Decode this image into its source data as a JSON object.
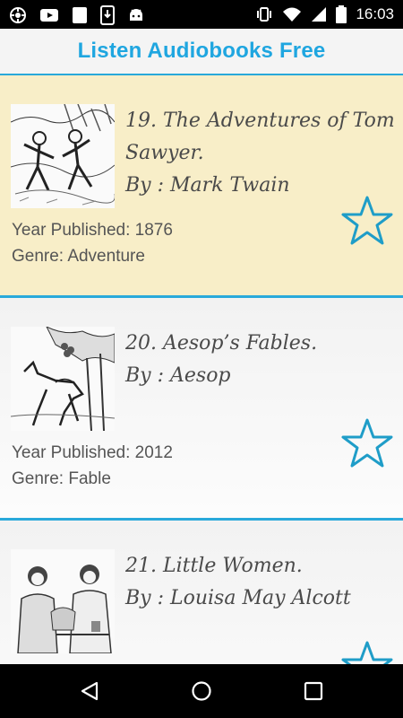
{
  "status_bar": {
    "time": "16:03",
    "left_icons": [
      "settings-wheel-icon",
      "youtube-icon",
      "blank-app-icon",
      "phone-download-icon",
      "android-icon"
    ],
    "right_icons": [
      "vibrate-icon",
      "wifi-icon",
      "signal-icon",
      "battery-icon"
    ]
  },
  "app": {
    "title": "Listen Audiobooks Free"
  },
  "books": [
    {
      "title": "19. The Adventures of Tom Sawyer.",
      "author_line": "By : Mark Twain",
      "year_line": "Year Published: 1876",
      "genre_line": "Genre: Adventure",
      "selected": true,
      "thumbnail": "boys-running-illustration"
    },
    {
      "title": "20. Aesop’s Fables.",
      "author_line": "By : Aesop",
      "year_line": "Year Published: 2012",
      "genre_line": "Genre: Fable",
      "selected": false,
      "thumbnail": "fox-and-grapes-illustration"
    },
    {
      "title": "21. Little Women.",
      "author_line": "By : Louisa May Alcott",
      "year_line": "",
      "genre_line": "",
      "selected": false,
      "thumbnail": "women-at-table-illustration"
    }
  ],
  "colors": {
    "accent": "#29a9da",
    "title_blue": "#1fa6e0",
    "selected_bg": "#f8eec8",
    "star_outline": "#1f9dc8"
  },
  "nav_bar": {
    "icons": [
      "back-icon",
      "home-icon",
      "recents-icon"
    ]
  }
}
